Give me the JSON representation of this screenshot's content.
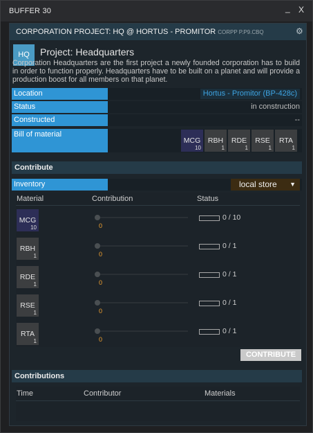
{
  "window": {
    "title": "BUFFER 30",
    "minimize": "_",
    "close": "X"
  },
  "panel": {
    "title": "CORPORATION PROJECT: HQ @ HORTUS - PROMITOR",
    "id": "CORPP P.P9.CBQ",
    "icon_label": "HQ",
    "project_title": "Project: Headquarters",
    "description": "Corporation Headquarters are the first project a newly founded corporation has to build in order to function properly. Headquarters have to be built on a planet and will provide a production boost for all members on that planet."
  },
  "info": {
    "location_label": "Location",
    "location_value": "Hortus - Promitor (BP-428c)",
    "status_label": "Status",
    "status_value": "in construction",
    "constructed_label": "Constructed",
    "constructed_value": "--",
    "bom_label": "Bill of material",
    "bom": [
      {
        "ticker": "MCG",
        "count": "10"
      },
      {
        "ticker": "RBH",
        "count": "1"
      },
      {
        "ticker": "RDE",
        "count": "1"
      },
      {
        "ticker": "RSE",
        "count": "1"
      },
      {
        "ticker": "RTA",
        "count": "1"
      }
    ]
  },
  "contribute": {
    "section_title": "Contribute",
    "inventory_label": "Inventory",
    "inventory_value": "local store",
    "caret": "▼",
    "col_material": "Material",
    "col_contribution": "Contribution",
    "col_status": "Status",
    "rows": [
      {
        "ticker": "MCG",
        "count": "10",
        "contribution": "0",
        "status": "0 / 10",
        "progress": 0
      },
      {
        "ticker": "RBH",
        "count": "1",
        "contribution": "0",
        "status": "0 / 1",
        "progress": 0
      },
      {
        "ticker": "RDE",
        "count": "1",
        "contribution": "0",
        "status": "0 / 1",
        "progress": 0
      },
      {
        "ticker": "RSE",
        "count": "1",
        "contribution": "0",
        "status": "0 / 1",
        "progress": 0
      },
      {
        "ticker": "RTA",
        "count": "1",
        "contribution": "0",
        "status": "0 / 1",
        "progress": 0
      }
    ],
    "button": "CONTRIBUTE"
  },
  "contributions": {
    "section_title": "Contributions",
    "col_time": "Time",
    "col_contributor": "Contributor",
    "col_materials": "Materials"
  }
}
